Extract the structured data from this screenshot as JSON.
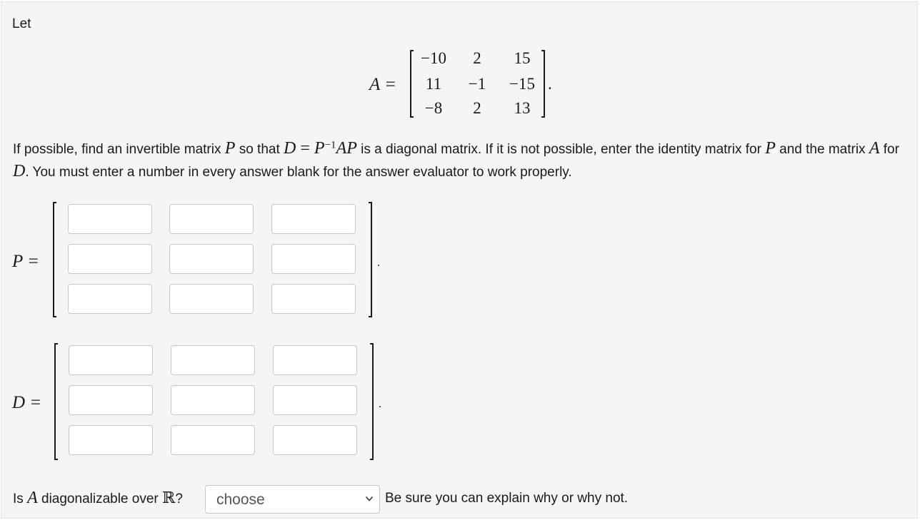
{
  "intro": "Let",
  "matrix_A": {
    "label": "A =",
    "rows": [
      [
        "−10",
        "2",
        "15"
      ],
      [
        "11",
        "−1",
        "−15"
      ],
      [
        "−8",
        "2",
        "13"
      ]
    ],
    "end_punct": "."
  },
  "instruction": {
    "p1": "If possible, find an invertible matrix ",
    "P": "P",
    "p2": " so that ",
    "D": "D",
    "eq": " = ",
    "P2": "P",
    "sup": "−1",
    "AP": "AP",
    "p3": " is a diagonal matrix. If it is not possible, enter the identity matrix for ",
    "P3": "P",
    "p4": " and the matrix ",
    "A": "A",
    "p5": " for ",
    "D2": "D",
    "p6": ". You must enter a number in every answer blank for the answer evaluator to work properly."
  },
  "matrix_P": {
    "label": "P =",
    "values": [
      [
        "",
        "",
        ""
      ],
      [
        "",
        "",
        ""
      ],
      [
        "",
        "",
        ""
      ]
    ],
    "end_punct": "."
  },
  "matrix_D": {
    "label": "D =",
    "values": [
      [
        "",
        "",
        ""
      ],
      [
        "",
        "",
        ""
      ],
      [
        "",
        "",
        ""
      ]
    ],
    "end_punct": "."
  },
  "question": {
    "pre": "Is ",
    "A": "A",
    "mid": " diagonalizable over ",
    "R": "ℝ",
    "q": "?",
    "select_value": "choose",
    "after": "Be sure you can explain why or why not."
  },
  "icons": {
    "select_arrow": "chevron-down-icon"
  }
}
